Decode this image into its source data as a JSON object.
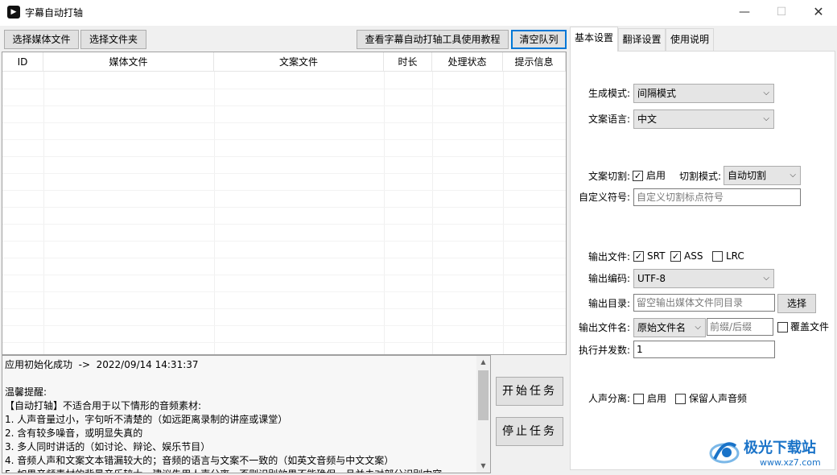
{
  "window": {
    "title": "字幕自动打轴",
    "app_icon_glyph": "▶",
    "controls": {
      "minimize": "—",
      "maximize": "☐",
      "close": "✕"
    }
  },
  "toolbar": {
    "select_media_label": "选择媒体文件",
    "select_folder_label": "选择文件夹",
    "tutorial_label": "查看字幕自动打轴工具使用教程",
    "clear_queue_label": "清空队列"
  },
  "table": {
    "columns": [
      "ID",
      "媒体文件",
      "文案文件",
      "时长",
      "处理状态",
      "提示信息"
    ],
    "rows": []
  },
  "log": {
    "text": "应用初始化成功  ->  2022/09/14 14:31:37\n\n温馨提醒:\n【自动打轴】不适合用于以下情形的音频素材:\n1. 人声音量过小，字句听不清楚的（如远距离录制的讲座或课堂）\n2. 含有较多噪音，或明显失真的\n3. 多人同时讲话的（如讨论、辩论、娱乐节目）\n4. 音频人声和文案文本错漏较大的；音频的语言与文案不一致的（如英文音频与中文文案）\n5. 如果音频素材的背景音乐较大，建议先用人声分离，否则识别效果不能确保，且并未对部分识别内容"
  },
  "actions": {
    "start_label": "开始任务",
    "stop_label": "停止任务"
  },
  "tabs": [
    {
      "label": "基本设置",
      "active": true
    },
    {
      "label": "翻译设置",
      "active": false
    },
    {
      "label": "使用说明",
      "active": false
    }
  ],
  "settings": {
    "mode_label": "生成模式:",
    "mode_value": "间隔模式",
    "language_label": "文案语言:",
    "language_value": "中文",
    "cut_label": "文案切割:",
    "cut_enable_label": "启用",
    "cut_enable_checked": true,
    "cut_mode_label": "切割模式:",
    "cut_mode_value": "自动切割",
    "symbol_label": "自定义符号:",
    "symbol_placeholder": "自定义切割标点符号",
    "output_file_label": "输出文件:",
    "srt_label": "SRT",
    "srt_checked": true,
    "ass_label": "ASS",
    "ass_checked": true,
    "lrc_label": "LRC",
    "lrc_checked": false,
    "encoding_label": "输出编码:",
    "encoding_value": "UTF-8",
    "dir_label": "输出目录:",
    "dir_placeholder": "留空输出媒体文件同目录",
    "dir_button_label": "选择",
    "filename_label": "输出文件名:",
    "filename_value": "原始文件名",
    "affix_placeholder": "前缀/后缀",
    "overwrite_label": "覆盖文件",
    "overwrite_checked": false,
    "concurrency_label": "执行并发数:",
    "concurrency_value": "1",
    "vocal_label": "人声分离:",
    "vocal_enable_label": "启用",
    "vocal_enable_checked": false,
    "keep_vocal_label": "保留人声音频",
    "keep_vocal_checked": false
  },
  "watermark": {
    "brand": "极光下载站",
    "url": "www.xz7.com"
  },
  "icons": {
    "check_glyph": "✓",
    "dropdown_glyph": "⌵",
    "scroll_up_glyph": "▲",
    "scroll_down_glyph": "▼"
  },
  "colors": {
    "accent": "#0078d7",
    "window_bg": "#f0f0f0",
    "watermark_blue": "#1a73c8"
  }
}
